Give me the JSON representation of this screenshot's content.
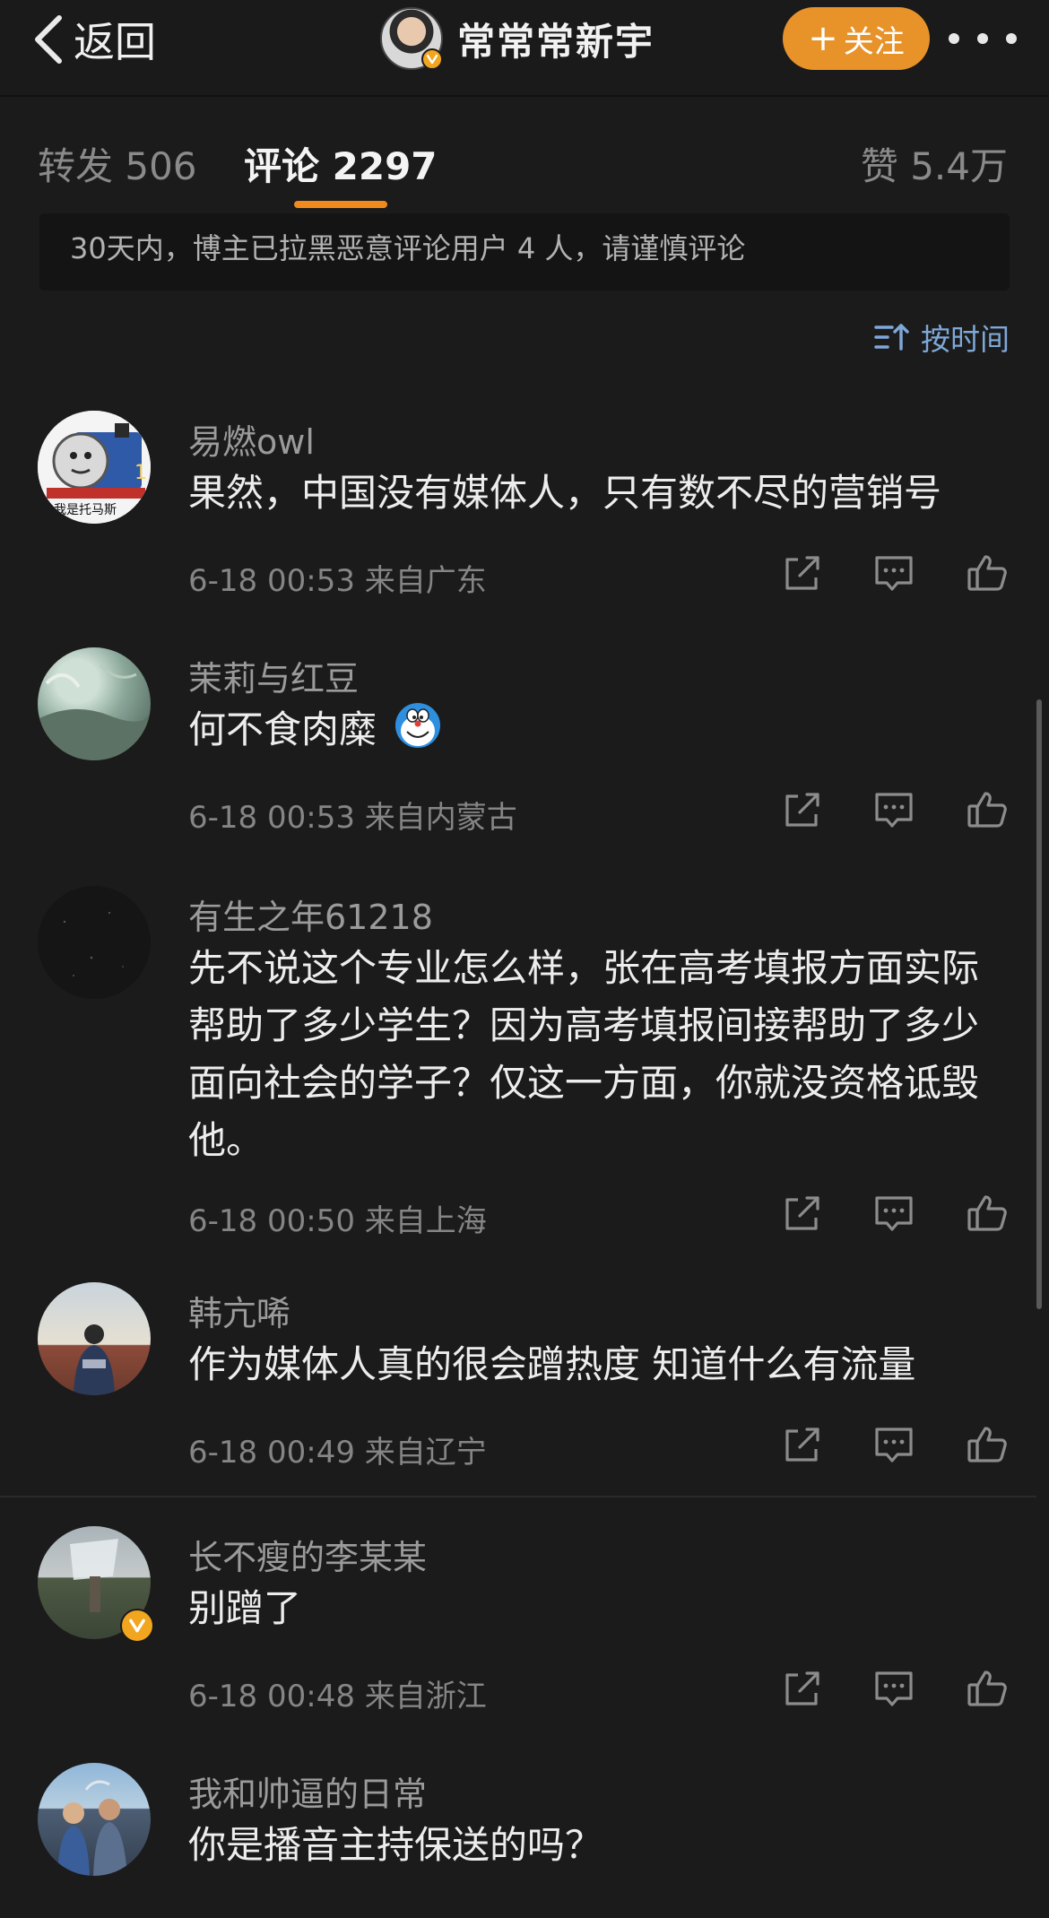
{
  "header": {
    "back_label": "返回",
    "account_name": "常常常新宇",
    "follow_label": "关注",
    "follow_plus": "+"
  },
  "tabs": {
    "repost": "转发 506",
    "comments": "评论 2297",
    "likes": "赞 5.4万"
  },
  "notice": "30天内，博主已拉黑恶意评论用户 4 人，请谨慎评论",
  "sort_label": "按时间",
  "comments": [
    {
      "name": "易燃owl",
      "text": "果然，中国没有媒体人，只有数不尽的营销号",
      "meta": "6-18 00:53  来自广东",
      "avatar_caption": "我是托马斯"
    },
    {
      "name": "茉莉与红豆",
      "text": "何不食肉糜",
      "meta": "6-18 00:53  来自内蒙古"
    },
    {
      "name": "有生之年61218",
      "text": "先不说这个专业怎么样，张在高考填报方面实际帮助了多少学生？因为高考填报间接帮助了多少面向社会的学子？仅这一方面，你就没资格诋毁他。",
      "meta": "6-18 00:50  来自上海"
    },
    {
      "name": "韩亢唏",
      "text": "作为媒体人真的很会蹭热度 知道什么有流量",
      "meta": "6-18 00:49  来自辽宁"
    },
    {
      "name": "长不瘦的李某某",
      "text": "别蹭了",
      "meta": "6-18 00:48  来自浙江"
    },
    {
      "name": "我和帅逼的日常",
      "text": "你是播音主持保送的吗？",
      "meta": ""
    }
  ],
  "colors": {
    "background": "#1b1b1b",
    "accent": "#f08a1c",
    "follow_button": "#e8922a",
    "sort_link": "#7ea8d8",
    "verified_badge": "#f2a51f"
  },
  "icons": [
    "chevron-left-icon",
    "verified-icon",
    "more-icon",
    "sort-icon",
    "share-icon",
    "comment-icon",
    "like-icon",
    "doraemon-emoji"
  ]
}
